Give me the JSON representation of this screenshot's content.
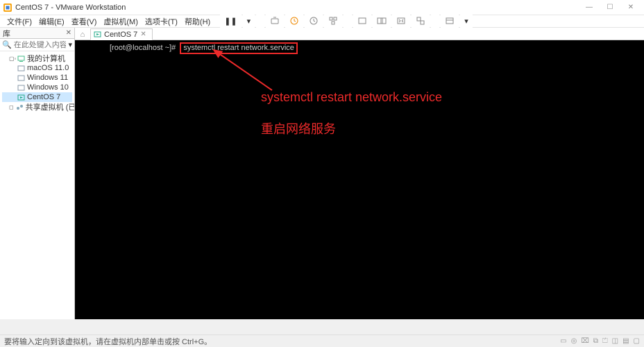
{
  "app": {
    "title": "CentOS 7 - VMware Workstation"
  },
  "winbtns": {
    "min": "—",
    "max": "☐",
    "close": "✕"
  },
  "menu": {
    "file": "文件(F)",
    "edit": "编辑(E)",
    "view": "查看(V)",
    "vm": "虚拟机(M)",
    "tabs": "选项卡(T)",
    "help": "帮助(H)"
  },
  "toolbar": {
    "dropdown": "▾"
  },
  "sidebar": {
    "header": "库",
    "search_placeholder": "在此处键入内容进行搜索",
    "items": {
      "root": "我的计算机",
      "mac": "macOS 11.0",
      "win11": "Windows 11",
      "win10": "Windows 10",
      "centos": "CentOS 7",
      "shared": "共享虚拟机 (已弃用)"
    }
  },
  "tabs": {
    "main": "CentOS 7"
  },
  "terminal": {
    "prompt": "[root@localhost ~]#",
    "command": "systemctl restart network.service"
  },
  "annotation": {
    "line1": "systemctl restart network.service",
    "line2": "重启网络服务"
  },
  "status": {
    "msg": "要将输入定向到该虚拟机，请在虚拟机内部单击或按 Ctrl+G。"
  }
}
